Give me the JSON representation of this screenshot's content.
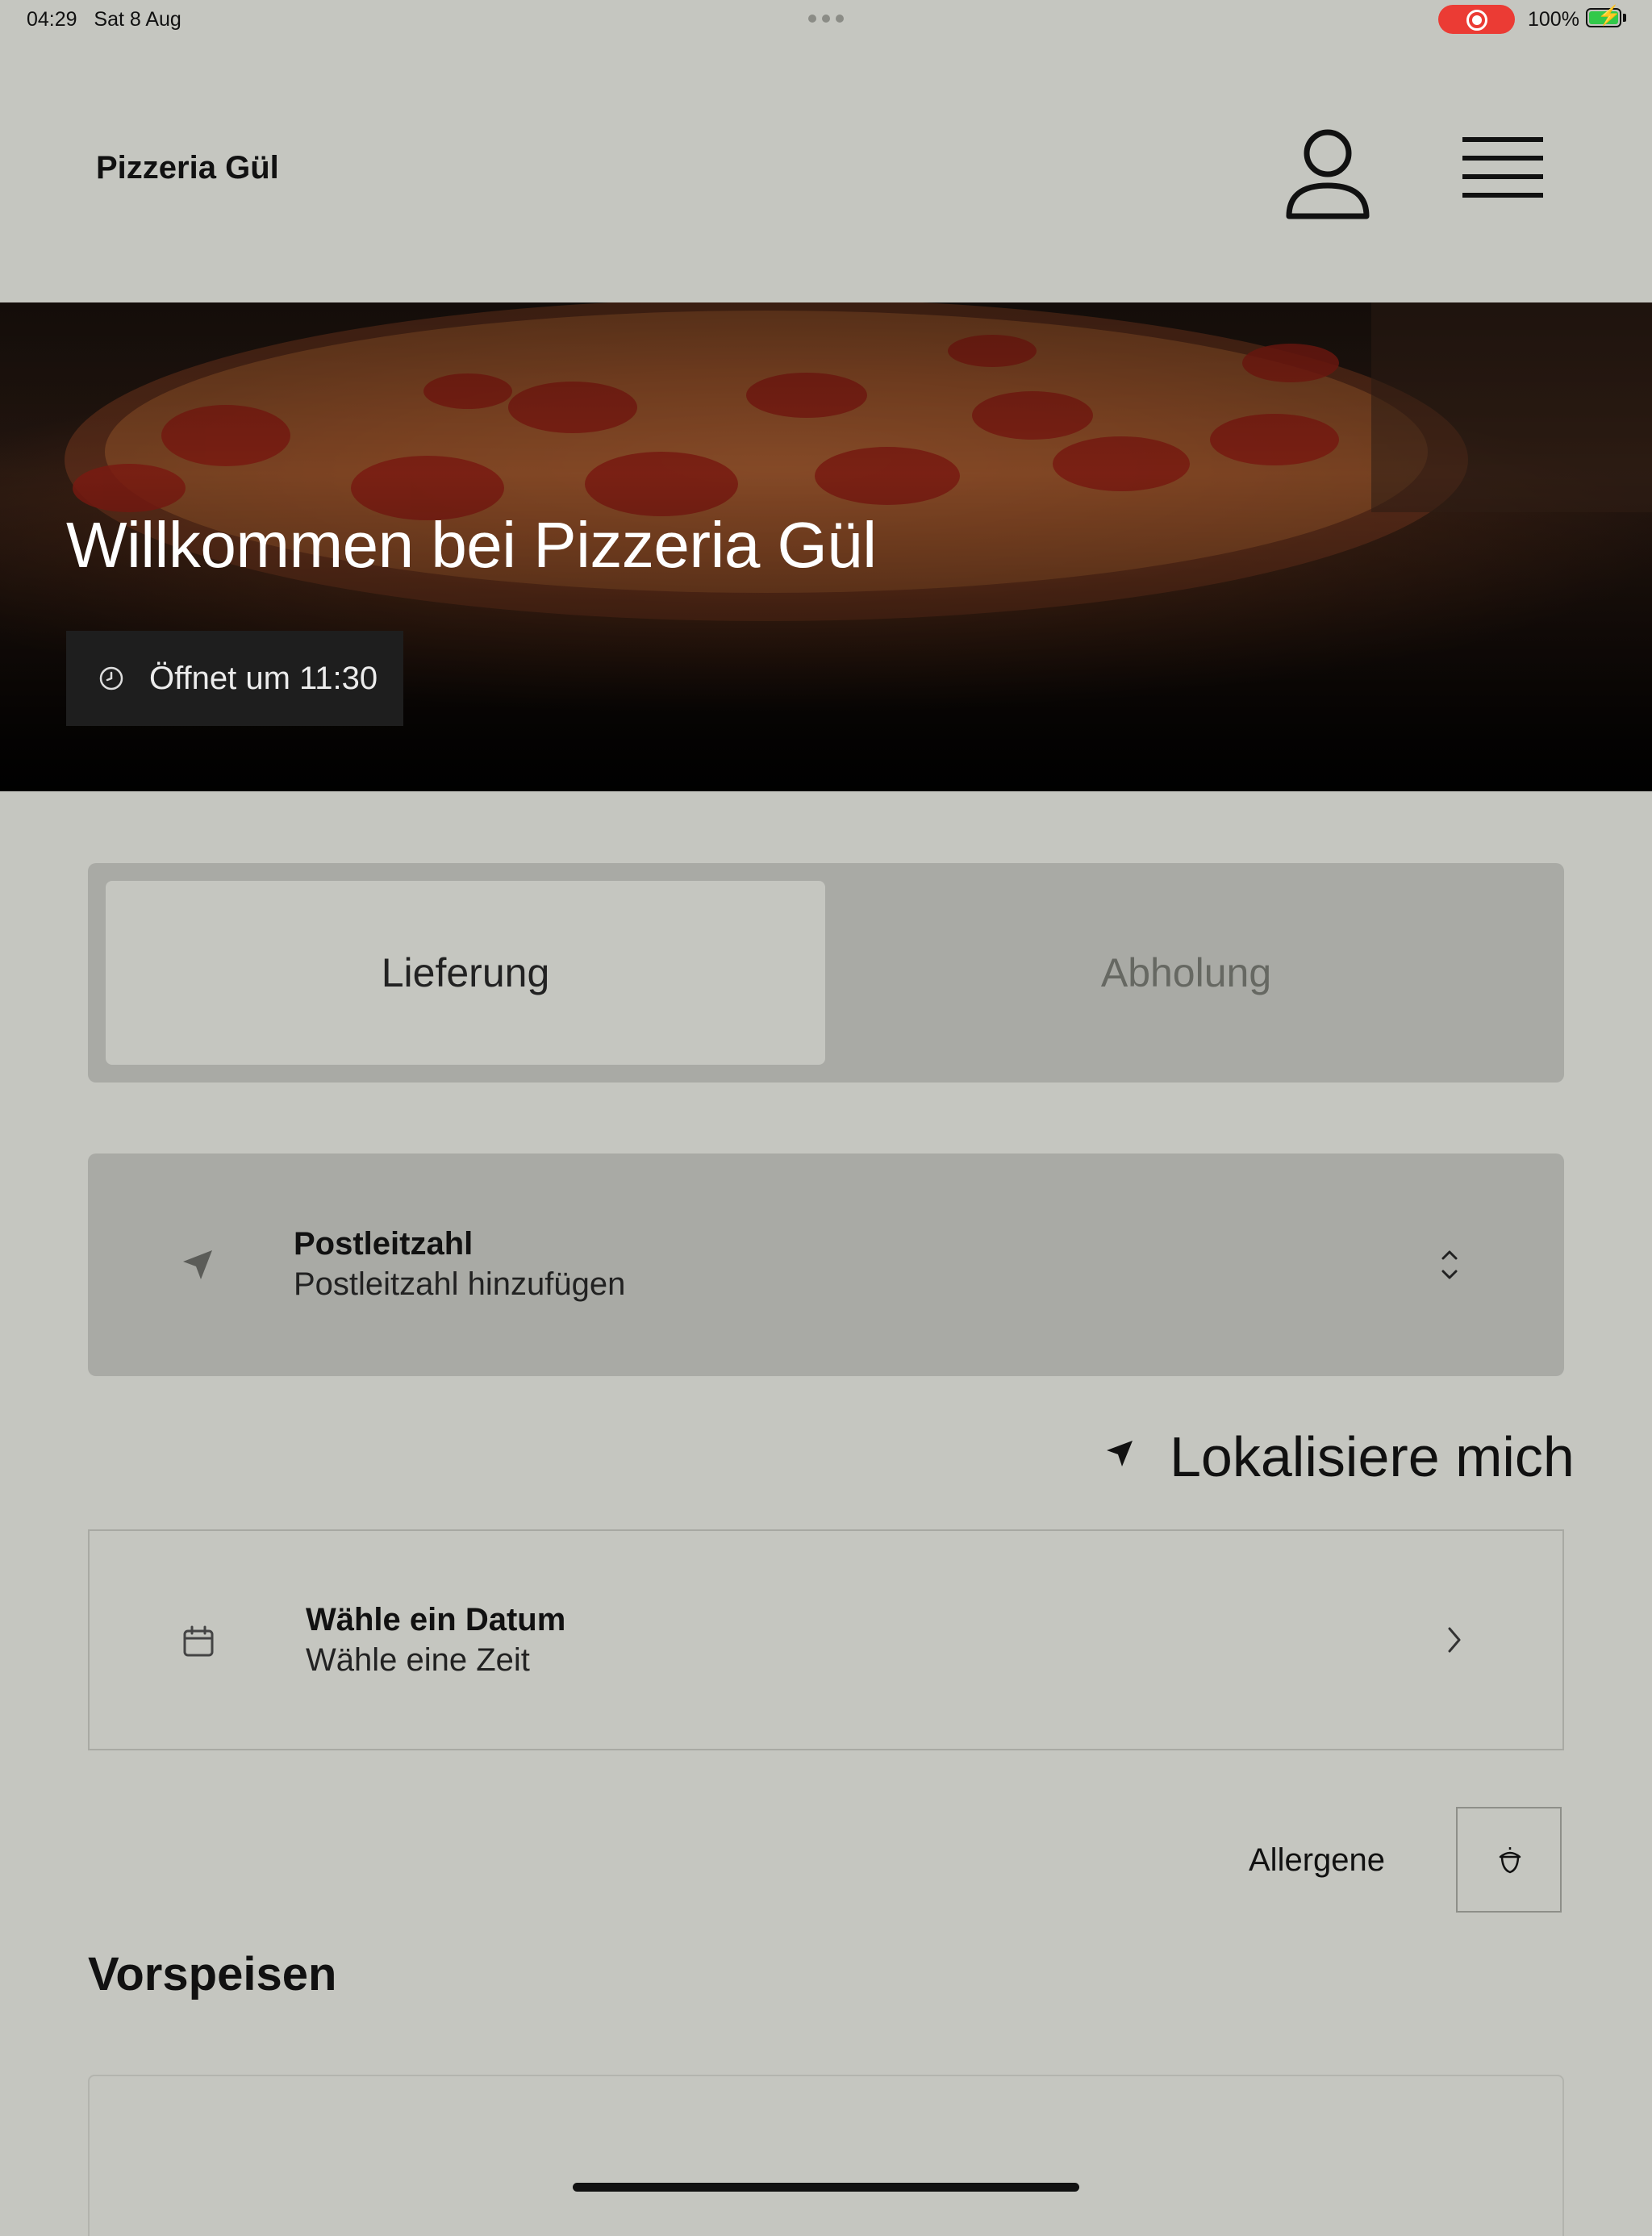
{
  "status_bar": {
    "time": "04:29",
    "date": "Sat 8 Aug",
    "battery": "100%",
    "record_color": "#eb3b34",
    "battery_color": "#32c94a"
  },
  "header": {
    "brand": "Pizzeria Gül",
    "user_icon": "user-icon",
    "menu_icon": "hamburger-menu-icon"
  },
  "hero": {
    "title": "Willkommen bei Pizzeria Gül",
    "opening": "Öffnet um 11:30",
    "clock_icon": "clock-icon"
  },
  "order_mode": {
    "options": [
      "Lieferung",
      "Abholung"
    ],
    "selected": "Lieferung"
  },
  "postcode": {
    "title": "Postleitzahl",
    "subtitle": "Postleitzahl hinzufügen",
    "icon": "location-arrow-icon",
    "chevron": "chevron-up-down-icon"
  },
  "locate": {
    "label": "Lokalisiere mich",
    "icon": "location-arrow-icon"
  },
  "schedule": {
    "title": "Wähle ein Datum",
    "subtitle": "Wähle eine Zeit",
    "icon": "calendar-icon",
    "chevron": "chevron-right-icon"
  },
  "allergens": {
    "label": "Allergene",
    "icon": "acorn-icon"
  },
  "menu_section": {
    "title": "Vorspeisen"
  },
  "colors": {
    "background": "#c5c6c0",
    "panel": "#a9aaa5",
    "badge": "#1e1e1e"
  }
}
